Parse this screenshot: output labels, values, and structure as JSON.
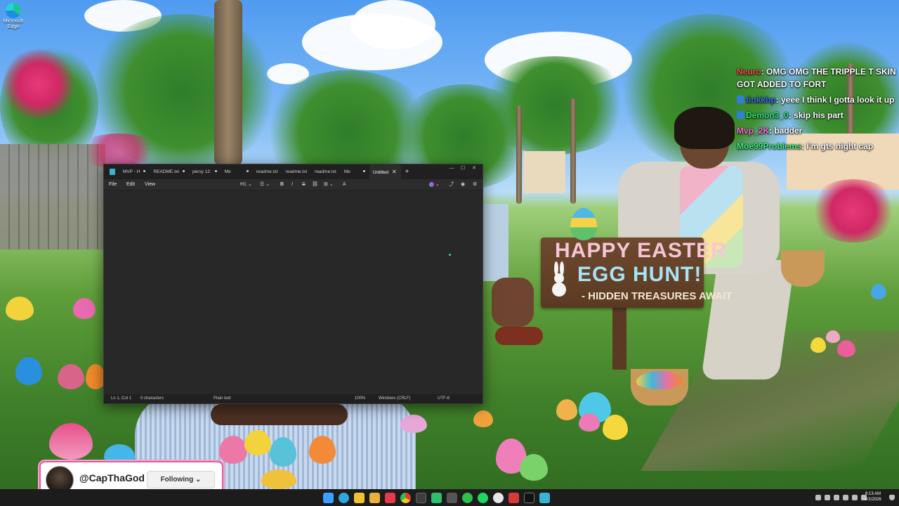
{
  "desktop": {
    "icon_label": "Microsoft Edge"
  },
  "wallpaper": {
    "sign_line1": "HAPPY EASTER",
    "sign_line2": "EGG HUNT!",
    "sign_line3": "- HIDDEN TREASURES AWAIT"
  },
  "chat": {
    "messages": [
      {
        "user": "Neuro",
        "user_color": "#ff4a4a",
        "text": ": OMG OMG THE TRIPPLE T SKIN GOT ADDED TO FORT",
        "badge": false
      },
      {
        "user": "tinkkhp",
        "user_color": "#3b6cf0",
        "text": ": yeee I think I gotta look it up",
        "badge": true
      },
      {
        "user": "Demon3_0",
        "user_color": "#2ee07a",
        "text": ": skip his part",
        "badge": true
      },
      {
        "user": "Mvp_2K",
        "user_color": "#ff6ad5",
        "text": ": badder",
        "badge": false
      },
      {
        "user": "Moe99Problems",
        "user_color": "#3df07a",
        "text": ": I'm gts night cap",
        "badge": false
      }
    ]
  },
  "notepad": {
    "tabs": [
      {
        "label": "MVP - H",
        "modified": true
      },
      {
        "label": "README.txt",
        "modified": true
      },
      {
        "label": "persy 12:",
        "modified": true
      },
      {
        "label": "Me",
        "modified": true
      },
      {
        "label": "readme.txt",
        "modified": false
      },
      {
        "label": "readme.txt",
        "modified": false
      },
      {
        "label": "readme.txt",
        "modified": false
      },
      {
        "label": "Me",
        "modified": true
      },
      {
        "label": "Untitled",
        "modified": false,
        "active": true
      }
    ],
    "new_tab": "+",
    "close_tab": "✕",
    "window_buttons": {
      "minimize": "—",
      "maximize": "☐",
      "close": "✕"
    },
    "menu": {
      "file": "File",
      "edit": "Edit",
      "view": "View"
    },
    "format": {
      "heading": "H1",
      "list": "☰",
      "bold": "B",
      "italic": "I",
      "strikethrough": "S",
      "link": "⛓",
      "table": "⊞",
      "clear": "A"
    },
    "status": {
      "position": "Ln 1, Col 1",
      "characters": "0 characters",
      "format": "Plain text",
      "zoom": "100%",
      "line_ending": "Windows (CRLF)",
      "encoding": "UTF-8"
    }
  },
  "follow_card": {
    "handle": "@CapThaGod",
    "button": "Following",
    "chevron": "⌄"
  },
  "taskbar": {
    "icons": [
      {
        "name": "start-icon",
        "color": "#3aa0ff"
      },
      {
        "name": "telegram-icon",
        "color": "#2ea6de"
      },
      {
        "name": "file-explorer-icon",
        "color": "#f2c233"
      },
      {
        "name": "folder-icon",
        "color": "#e9b13a"
      },
      {
        "name": "app-red-icon",
        "color": "#e53a4a"
      },
      {
        "name": "chrome-icon",
        "color": "#f2b233"
      },
      {
        "name": "terminal-icon",
        "color": "#3d3d3d"
      },
      {
        "name": "app-green-icon",
        "color": "#2fbf6a"
      },
      {
        "name": "calculator-icon",
        "color": "#555555"
      },
      {
        "name": "xbox-icon",
        "color": "#2fbf4a"
      },
      {
        "name": "spotify-icon",
        "color": "#1ed760"
      },
      {
        "name": "obs-icon",
        "color": "#e6e6e6"
      },
      {
        "name": "roblox-icon",
        "color": "#d83a3a"
      },
      {
        "name": "x-icon",
        "color": "#111111"
      },
      {
        "name": "notepad-icon",
        "color": "#38b3d4"
      }
    ],
    "clock_time": "6:13 AM",
    "clock_date": "4/1/2026"
  }
}
